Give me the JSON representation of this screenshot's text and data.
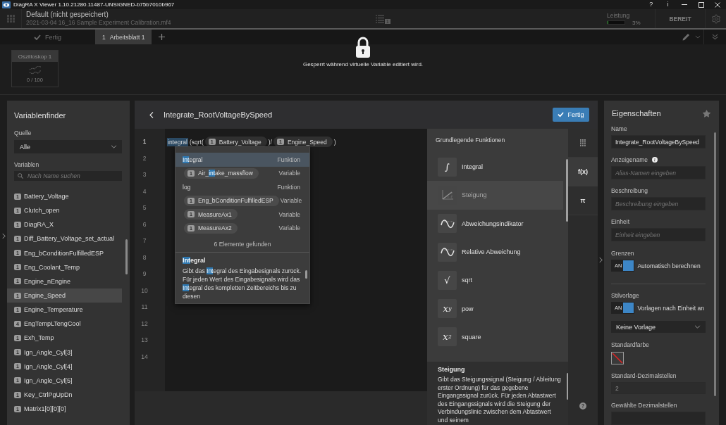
{
  "window": {
    "title": "DiagRA X Viewer 1.10.21280.11487-UNSIGNED-b75b7010b967",
    "buttons": [
      "?",
      "i"
    ]
  },
  "header": {
    "project": "Default (nicht gespeichert)",
    "file": "2021-03-04 16_16 Sample Experiment Calibration.mf4",
    "queue_count": "1",
    "performance": {
      "label": "Leistung",
      "level": 0.03,
      "reading": "3%"
    },
    "status": "BEREIT"
  },
  "tab_bar": {
    "done": {
      "label": "Fertig",
      "disabled": true
    },
    "tabs": [
      {
        "number": "1",
        "label": "Arbeitsblatt 1",
        "selected": true
      }
    ]
  },
  "worksheet": {
    "cards": [
      {
        "title": "Oszilloskop 1",
        "count": "0 / 100"
      }
    ],
    "lock_message": "Gesperrt während virtuelle Variable editiert wird."
  },
  "variable_finder": {
    "title": "Variablenfinder",
    "source_label": "Quelle",
    "source_value": "Alle",
    "variables_label": "Variablen",
    "search_placeholder": "Nach Name suchen",
    "items": [
      {
        "badge": "1",
        "name": "Battery_Voltage",
        "selected": false
      },
      {
        "badge": "1",
        "name": "Clutch_open",
        "selected": false
      },
      {
        "badge": "1",
        "name": "DiagRA_X",
        "selected": false
      },
      {
        "badge": "1",
        "name": "Diff_Battery_Voltage_set_actual",
        "selected": false
      },
      {
        "badge": "1",
        "name": "Eng_bConditionFulfilledESP",
        "selected": false
      },
      {
        "badge": "1",
        "name": "Eng_Coolant_Temp",
        "selected": false
      },
      {
        "badge": "1",
        "name": "Engine_nEngine",
        "selected": false
      },
      {
        "badge": "1",
        "name": "Engine_Speed",
        "selected": true
      },
      {
        "badge": "1",
        "name": "Engine_Temperature",
        "selected": false
      },
      {
        "badge": "4",
        "name": "EngTempLTengCool",
        "selected": false
      },
      {
        "badge": "1",
        "name": "Exh_Temp",
        "selected": false
      },
      {
        "badge": "1",
        "name": "Ign_Angle_Cyl[3]",
        "selected": false
      },
      {
        "badge": "1",
        "name": "Ign_Angle_Cyl[4]",
        "selected": false
      },
      {
        "badge": "1",
        "name": "Ign_Angle_Cyl[5]",
        "selected": false
      },
      {
        "badge": "1",
        "name": "Key_CtrlPgUpDn",
        "selected": false
      },
      {
        "badge": "1",
        "name": "Matrix1[0][0][0]",
        "selected": false
      }
    ]
  },
  "editor": {
    "title": "Integrate_RootVoltageBySpeed",
    "done_button": "Fertig",
    "line_numbers": [
      {
        "number": "1",
        "current": true
      },
      {
        "number": "2",
        "current": false
      },
      {
        "number": "3",
        "current": false
      },
      {
        "number": "4",
        "current": false
      },
      {
        "number": "5",
        "current": false
      },
      {
        "number": "6",
        "current": false
      },
      {
        "number": "7",
        "current": false
      },
      {
        "number": "8",
        "current": false
      },
      {
        "number": "9",
        "current": false
      },
      {
        "number": "10",
        "current": false
      },
      {
        "number": "11",
        "current": false
      },
      {
        "number": "12",
        "current": false
      },
      {
        "number": "13",
        "current": false
      },
      {
        "number": "14",
        "current": false
      }
    ],
    "code": [
      {
        "kind": "function",
        "text": "integral",
        "highlighted": true
      },
      {
        "kind": "text",
        "text": "(sqrt(",
        "highlighted": false
      },
      {
        "kind": "variable",
        "badge": "1",
        "text": "Battery_Voltage",
        "highlighted": false
      },
      {
        "kind": "text",
        "text": ")/",
        "highlighted": false
      },
      {
        "kind": "variable",
        "badge": "1",
        "text": "Engine_Speed",
        "highlighted": false
      },
      {
        "kind": "text",
        "text": ")",
        "highlighted": false
      }
    ],
    "autocomplete": {
      "items": [
        {
          "kind": "function",
          "parts": [
            {
              "text": "Int",
              "highlight": true
            },
            {
              "text": "egral",
              "highlight": false
            }
          ],
          "type": "Funktion",
          "selected": true
        },
        {
          "kind": "variable",
          "badge": "1",
          "parts": [
            {
              "text": "Air_",
              "highlight": false
            },
            {
              "text": "int",
              "highlight": true
            },
            {
              "text": "ake_massflow",
              "highlight": false
            }
          ],
          "type": "Variable",
          "selected": false
        },
        {
          "kind": "function",
          "parts": [
            {
              "text": "log",
              "highlight": false
            }
          ],
          "type": "Funktion",
          "selected": false
        },
        {
          "kind": "variable",
          "badge": "1",
          "parts": [
            {
              "text": "Eng_bConditionFulfilledESP",
              "highlight": false
            }
          ],
          "type": "Variable",
          "selected": false
        },
        {
          "kind": "variable",
          "badge": "1",
          "parts": [
            {
              "text": "MeasureAx1",
              "highlight": false
            }
          ],
          "type": "Variable",
          "selected": false
        },
        {
          "kind": "variable",
          "badge": "1",
          "parts": [
            {
              "text": "MeasureAx2",
              "highlight": false
            }
          ],
          "type": "Variable",
          "selected": false
        }
      ],
      "count": "6 Elemente gefunden",
      "detail": {
        "title_parts": [
          {
            "text": "Int",
            "highlight": true
          },
          {
            "text": "egral",
            "highlight": false
          }
        ],
        "text_parts": [
          {
            "text": "Gibt das ",
            "highlight": false
          },
          {
            "text": "Int",
            "highlight": true
          },
          {
            "text": "egral des Eingabesignals zurück. Für jeden Wert des Eingabesignals wird das ",
            "highlight": false
          },
          {
            "text": "Int",
            "highlight": true
          },
          {
            "text": "egral des kompletten Zeitbereichs bis zu diesen",
            "highlight": false
          }
        ]
      }
    }
  },
  "functions": {
    "title": "Grundlegende Funktionen",
    "items": [
      {
        "kind": "glyph",
        "symbol": "∫",
        "label": "Integral",
        "selected": false
      },
      {
        "kind": "slope",
        "label": "Steigung",
        "selected": true
      },
      {
        "kind": "wave",
        "label": "Abweichungsindikator",
        "selected": false
      },
      {
        "kind": "wave",
        "label": "Relative Abweichung",
        "selected": false
      },
      {
        "kind": "glyph",
        "symbol": "√",
        "label": "sqrt",
        "selected": false
      },
      {
        "kind": "glyph",
        "symbol": "*x*$^{y}$",
        "label": "pow",
        "selected": false
      },
      {
        "kind": "glyph",
        "symbol": "*x*$^{2}$",
        "label": "square",
        "selected": false
      }
    ],
    "detail": {
      "title": "Steigung",
      "text": "Gibt das Steigungssignal (Steigung / Ableitung erster Ordnung) für das gegebene Eingangssignal zurück. Für jeden Abtastwert des Eingangssignals wird die Steigung der Verbindungslinie zwischen dem Abtastwert und seinem"
    }
  },
  "side_tabs": [
    {
      "kind": "keypad",
      "selected": false
    },
    {
      "kind": "text",
      "label": "f(x)",
      "selected": true
    },
    {
      "kind": "text",
      "label": "π",
      "selected": false
    }
  ],
  "properties": {
    "title": "Eigenschaften",
    "sections": [
      {
        "fields": [
          {
            "kind": "input",
            "label": "Name",
            "value": "Integrate_RootVoltageBySpeed",
            "info": false,
            "disabled": false
          },
          {
            "kind": "input",
            "label": "Anzeigename",
            "placeholder": "Alias-Namen eingeben",
            "info": true,
            "disabled": false
          },
          {
            "kind": "input",
            "label": "Beschreibung",
            "placeholder": "Beschreibung eingeben",
            "info": false,
            "disabled": false
          },
          {
            "kind": "input",
            "label": "Einheit",
            "placeholder": "Einheit eingeben",
            "info": false,
            "disabled": false
          },
          {
            "kind": "toggle",
            "label": "Grenzen",
            "switch_text": "AN",
            "on": true,
            "text": "Automatisch berechnen"
          }
        ]
      },
      {
        "fields": [
          {
            "kind": "toggle",
            "label": "Stilvorlage",
            "switch_text": "AN",
            "on": true,
            "text": "Vorlagen nach Einheit an"
          },
          {
            "kind": "select",
            "value": "Keine Vorlage"
          },
          {
            "kind": "color",
            "label": "Standardfarbe",
            "assigned": false
          },
          {
            "kind": "input",
            "label": "Standard-Dezimalstellen",
            "value": "2",
            "info": false,
            "disabled": true
          },
          {
            "kind": "input",
            "label": "Gewählte Dezimalstellen",
            "info": false,
            "disabled": false
          }
        ]
      }
    ]
  }
}
